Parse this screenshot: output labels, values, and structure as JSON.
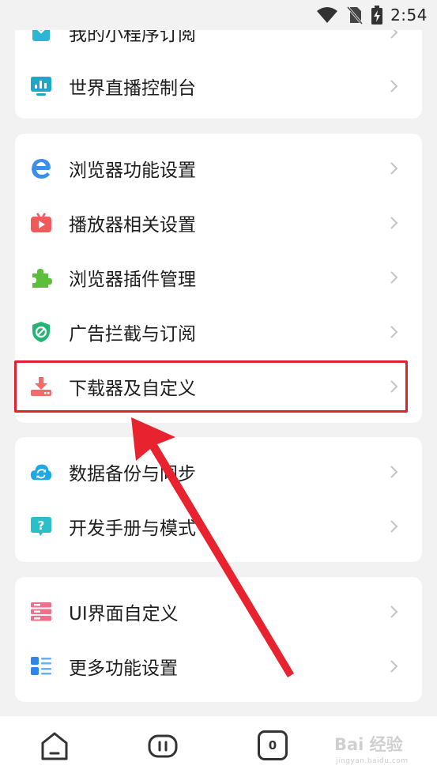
{
  "status_bar": {
    "time": "2:54"
  },
  "groups": [
    {
      "name": "group-1",
      "items": [
        {
          "label": "我的小程序订阅",
          "icon": "mini-program-icon",
          "color": "#2bb6d4"
        },
        {
          "label": "世界直播控制台",
          "icon": "monitor-chart-icon",
          "color": "#1ea8c7"
        }
      ]
    },
    {
      "name": "group-2",
      "items": [
        {
          "label": "浏览器功能设置",
          "icon": "browser-e-icon",
          "color": "#3b8fea"
        },
        {
          "label": "播放器相关设置",
          "icon": "tv-play-icon",
          "color": "#f05a5a"
        },
        {
          "label": "浏览器插件管理",
          "icon": "puzzle-icon",
          "color": "#5cbf3c"
        },
        {
          "label": "广告拦截与订阅",
          "icon": "shield-block-icon",
          "color": "#22b573"
        },
        {
          "label": "下载器及自定义",
          "icon": "download-icon",
          "color": "#f26b6b"
        }
      ]
    },
    {
      "name": "group-3",
      "items": [
        {
          "label": "数据备份与同步",
          "icon": "cloud-sync-icon",
          "color": "#1ea8e0"
        },
        {
          "label": "开发手册与模式",
          "icon": "help-bubble-icon",
          "color": "#2bbfc9"
        }
      ]
    },
    {
      "name": "group-4",
      "items": [
        {
          "label": "UI界面自定义",
          "icon": "ui-layers-icon",
          "color": "#f0708c"
        },
        {
          "label": "更多功能设置",
          "icon": "list-grid-icon",
          "color": "#2f86e8"
        }
      ]
    }
  ],
  "bottom_nav": {
    "tab_count": "0"
  },
  "watermark": {
    "text": "Bai 经验",
    "sub": "jingyan.baidu.com"
  },
  "colors": {
    "highlight": "#e2202f",
    "background": "#f2f2f2",
    "card": "#ffffff"
  }
}
